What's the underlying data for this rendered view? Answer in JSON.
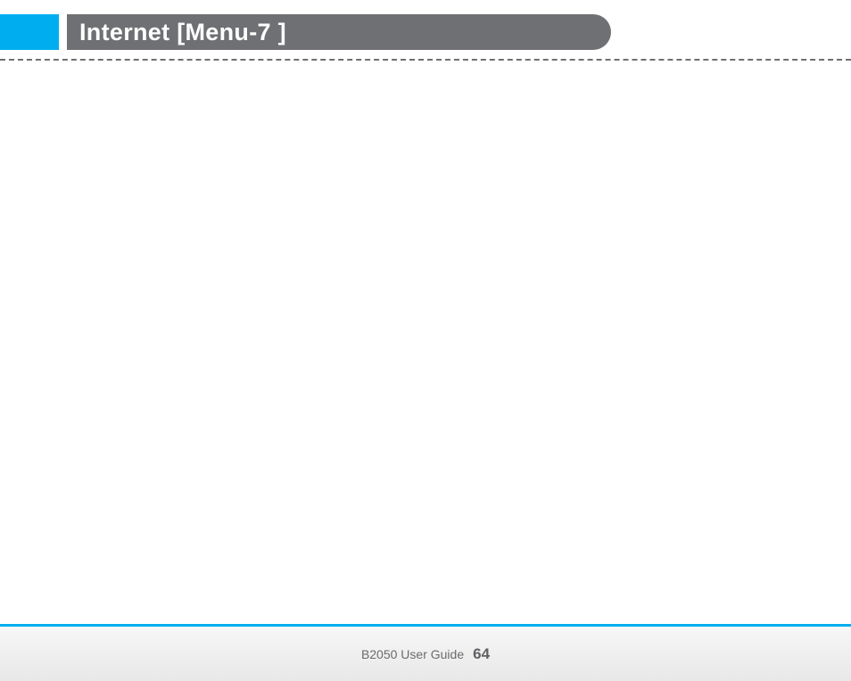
{
  "header": {
    "title": "Internet [Menu-7 ]"
  },
  "footer": {
    "guide_label": "B2050 User Guide",
    "page_number": "64"
  },
  "colors": {
    "accent": "#00aeef",
    "pill": "#6f7073"
  }
}
